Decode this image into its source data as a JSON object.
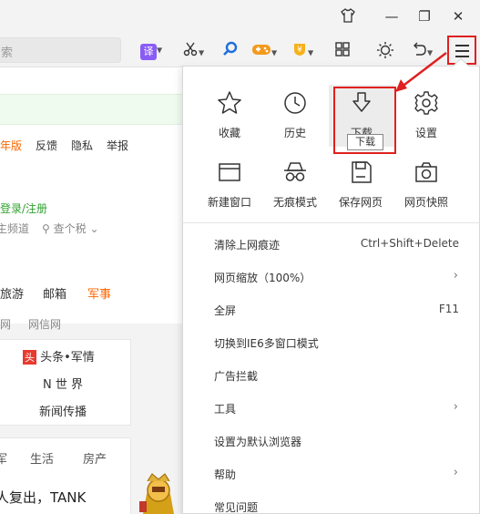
{
  "window": {
    "skin_icon": "shirt-icon",
    "minimize": "—",
    "restore": "❐",
    "close": "✕"
  },
  "toolbar": {
    "search_placeholder": "索",
    "translate": "译",
    "menu_icon": "hamburger-icon"
  },
  "web": {
    "top_links": [
      "年版",
      "反馈",
      "隐私",
      "举报"
    ],
    "login": "登录/注册",
    "row2": [
      "主频道",
      "查个税"
    ],
    "nav": [
      "旅游",
      "邮箱",
      "军事"
    ],
    "sub_nav": [
      "网",
      "网信网"
    ],
    "news_panel": [
      "头条•军情",
      "N 世 界",
      "新闻传播"
    ],
    "news_badge": "头",
    "cats": [
      "军",
      "生活",
      "房产"
    ],
    "headline": "人复出，TANK"
  },
  "menu": {
    "tiles": [
      {
        "label": "收藏",
        "icon": "star-icon"
      },
      {
        "label": "历史",
        "icon": "clock-icon"
      },
      {
        "label": "下载",
        "icon": "download-icon"
      },
      {
        "label": "设置",
        "icon": "gear-icon"
      },
      {
        "label": "新建窗口",
        "icon": "new-window-icon"
      },
      {
        "label": "无痕模式",
        "icon": "incognito-icon"
      },
      {
        "label": "保存网页",
        "icon": "save-icon"
      },
      {
        "label": "网页快照",
        "icon": "camera-icon"
      }
    ],
    "tooltip": "下载",
    "items": [
      {
        "label": "清除上网痕迹",
        "shortcut": "Ctrl+Shift+Delete"
      },
      {
        "label": "网页缩放（100%）",
        "shortcut": ""
      },
      {
        "label": "全屏",
        "shortcut": "F11"
      },
      {
        "label": "切换到IE6多窗口模式",
        "shortcut": ""
      },
      {
        "label": "广告拦截",
        "shortcut": ""
      },
      {
        "label": "工具",
        "shortcut": ""
      },
      {
        "label": "设置为默认浏览器",
        "shortcut": ""
      },
      {
        "label": "帮助",
        "shortcut": ""
      },
      {
        "label": "常见问题",
        "shortcut": ""
      }
    ]
  },
  "colors": {
    "highlight_red": "#e02020",
    "accent_orange": "#ff6600",
    "link_green": "#2fa12f"
  }
}
